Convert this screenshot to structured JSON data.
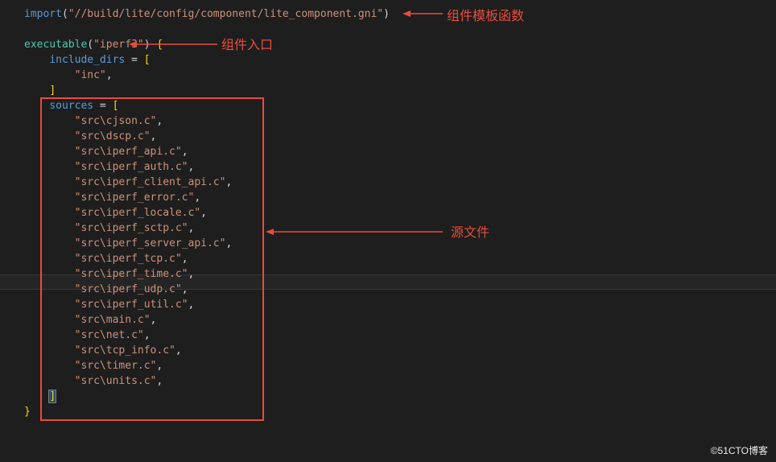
{
  "code": {
    "import_kw": "import",
    "import_path": "\"//build/lite/config/component/lite_component.gni\"",
    "executable_kw": "executable",
    "target_name": "\"iperf3\"",
    "include_dirs_kw": "include_dirs",
    "include_dirs": [
      "\"inc\""
    ],
    "sources_kw": "sources",
    "sources": [
      "\"src\\cjson.c\"",
      "\"src\\dscp.c\"",
      "\"src\\iperf_api.c\"",
      "\"src\\iperf_auth.c\"",
      "\"src\\iperf_client_api.c\"",
      "\"src\\iperf_error.c\"",
      "\"src\\iperf_locale.c\"",
      "\"src\\iperf_sctp.c\"",
      "\"src\\iperf_server_api.c\"",
      "\"src\\iperf_tcp.c\"",
      "\"src\\iperf_time.c\"",
      "\"src\\iperf_udp.c\"",
      "\"src\\iperf_util.c\"",
      "\"src\\main.c\"",
      "\"src\\net.c\"",
      "\"src\\tcp_info.c\"",
      "\"src\\timer.c\"",
      "\"src\\units.c\""
    ]
  },
  "annotations": {
    "template_func": "组件模板函数",
    "entry": "组件入口",
    "source_files": "源文件"
  },
  "watermark": "©51CTO博客"
}
